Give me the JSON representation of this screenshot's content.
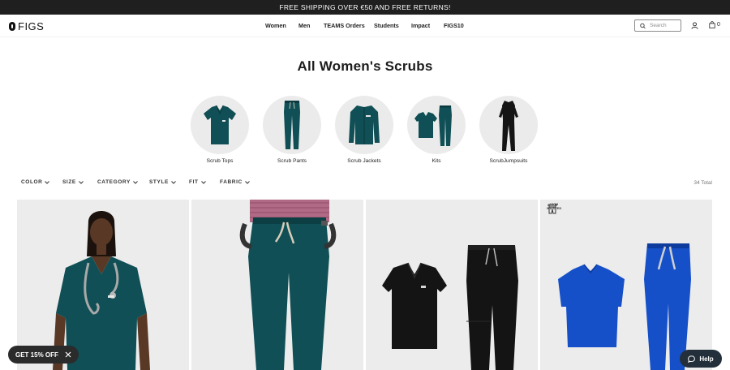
{
  "promo": {
    "text": "FREE SHIPPING OVER €50 AND FREE RETURNS!"
  },
  "header": {
    "logo": "FIGS",
    "nav": [
      "Women",
      "Men",
      "TEAMS Orders",
      "Students",
      "Impact",
      "FIGS10"
    ],
    "search_placeholder": "Search",
    "cart_count": "0"
  },
  "page": {
    "title": "All Women's Scrubs"
  },
  "categories": [
    {
      "label": "Scrub Tops",
      "icon": "scrub-top"
    },
    {
      "label": "Scrub Pants",
      "icon": "scrub-pants"
    },
    {
      "label": "Scrub Jackets",
      "icon": "scrub-jacket"
    },
    {
      "label": "Kits",
      "icon": "kit"
    },
    {
      "label": "ScrubJumpsuits",
      "icon": "jumpsuit"
    }
  ],
  "filters": {
    "items": [
      "COLOR",
      "SIZE",
      "CATEGORY",
      "STYLE",
      "FIT",
      "FABRIC"
    ],
    "total": "34 Total"
  },
  "products": [
    {
      "name": "model-teal-scrub-top",
      "color": "#0f4f55"
    },
    {
      "name": "teal-scrub-pants",
      "color": "#0f4f55"
    },
    {
      "name": "black-scrub-kit",
      "color": "#141414"
    },
    {
      "name": "royal-blue-scrub-kit",
      "color": "#1550c9",
      "badge": "HIGH WAISTED"
    }
  ],
  "discount": {
    "label": "GET 15% OFF"
  },
  "help": {
    "label": "Help"
  },
  "colors": {
    "teal": "#0f4f55",
    "dark": "#1f1f1f",
    "help": "#232f3a",
    "royal": "#1550c9"
  }
}
